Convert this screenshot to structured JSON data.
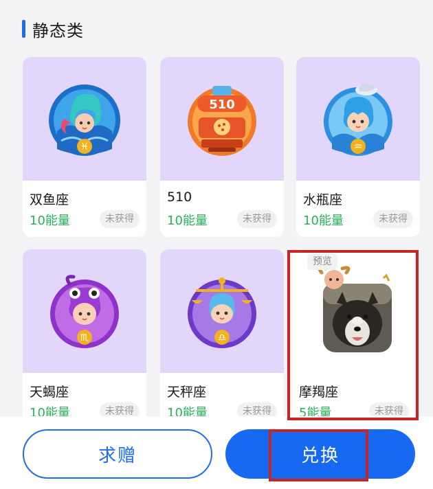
{
  "section": {
    "title": "静态类"
  },
  "cards": [
    {
      "name": "双鱼座",
      "energy": "10能量",
      "status": "未获得",
      "icon": "pisces-mermaid-badge-icon"
    },
    {
      "name": "510",
      "energy": "10能量",
      "status": "未获得",
      "icon": "510-train-badge-icon"
    },
    {
      "name": "水瓶座",
      "energy": "10能量",
      "status": "未获得",
      "icon": "aquarius-badge-icon"
    },
    {
      "name": "天蝎座",
      "energy": "10能量",
      "status": "未获得",
      "icon": "scorpio-badge-icon"
    },
    {
      "name": "天秤座",
      "energy": "10能量",
      "status": "未获得",
      "icon": "libra-badge-icon"
    },
    {
      "name": "摩羯座",
      "energy": "5能量",
      "status": "未获得",
      "icon": "capricorn-dog-photo-avatar",
      "preview_label": "预览",
      "selected": true
    }
  ],
  "buttons": {
    "request_gift": "求赠",
    "exchange": "兑换"
  },
  "colors": {
    "accent": "#1e6cf2",
    "energy": "#2ab15a",
    "card_thumb": "#e2d7fb",
    "highlight": "#c82426"
  }
}
